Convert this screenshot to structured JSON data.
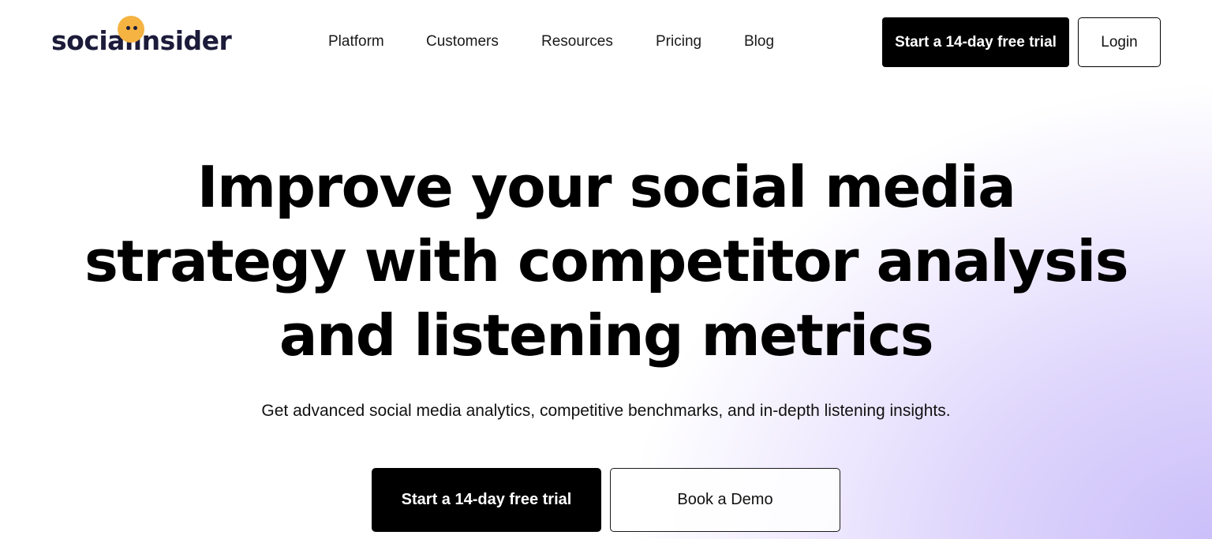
{
  "header": {
    "logo_text": "socialinsider",
    "logo_icon": "smiley-dot-icon",
    "nav": [
      {
        "label": "Platform"
      },
      {
        "label": "Customers"
      },
      {
        "label": "Resources"
      },
      {
        "label": "Pricing"
      },
      {
        "label": "Blog"
      }
    ],
    "trial_button": "Start a 14-day free trial",
    "login_button": "Login"
  },
  "hero": {
    "title_lines": [
      "Improve your social media",
      "strategy with competitor analysis",
      "and listening metrics"
    ],
    "subtitle": "Get advanced social media analytics, competitive benchmarks, and in-depth listening insights.",
    "trial_button": "Start a 14-day free trial",
    "demo_button": "Book a Demo"
  },
  "colors": {
    "brand_dark": "#1c1b3a",
    "brand_accent": "#f5b342",
    "gradient_purple": "#c9bdf9"
  }
}
